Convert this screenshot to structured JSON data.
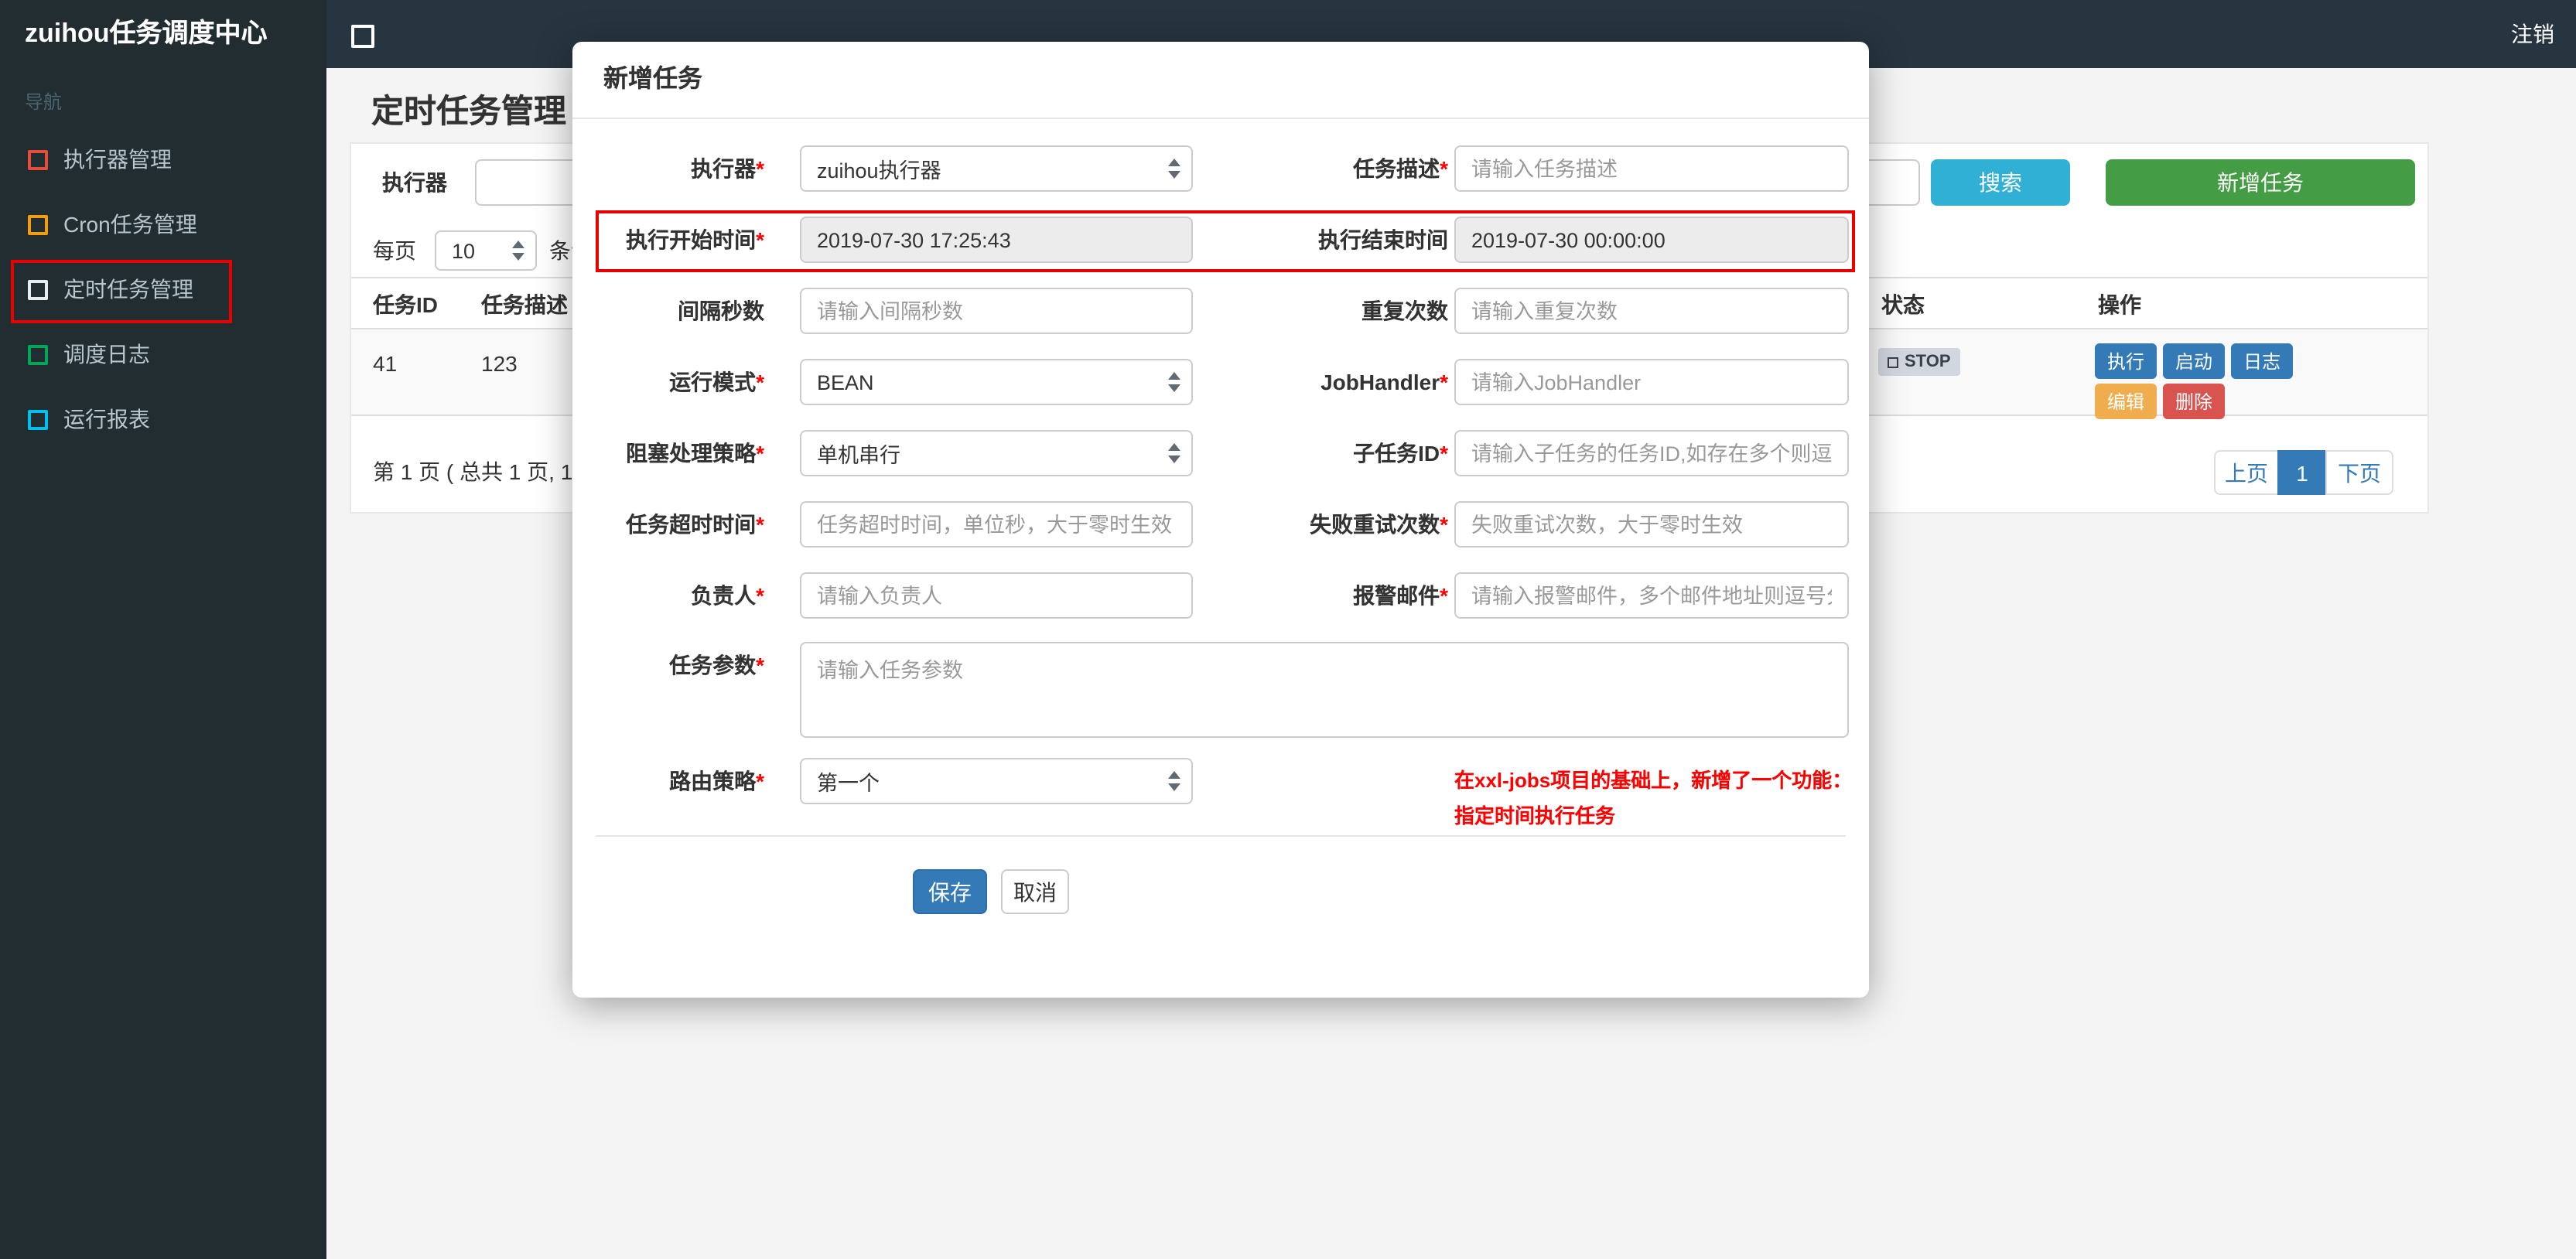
{
  "navbar": {
    "brand": "zuihou任务调度中心",
    "logout": "注销"
  },
  "sidebar": {
    "section_label": "导航",
    "items": [
      {
        "label": "执行器管理",
        "icon": "square-icon",
        "color": "#e74c3c"
      },
      {
        "label": "Cron任务管理",
        "icon": "square-icon",
        "color": "#f39c12"
      },
      {
        "label": "定时任务管理",
        "icon": "square-icon",
        "color": "#e8eef0",
        "highlighted": true
      },
      {
        "label": "调度日志",
        "icon": "square-icon",
        "color": "#00a65a"
      },
      {
        "label": "运行报表",
        "icon": "square-icon",
        "color": "#00c0ef"
      }
    ]
  },
  "page": {
    "title": "定时任务管理",
    "filter": {
      "executor_label": "执行器",
      "search_button": "搜索",
      "add_button": "新增任务"
    },
    "per_page": {
      "prefix": "每页",
      "value": "10",
      "suffix": "条记录"
    },
    "table": {
      "headers": {
        "job_id": "任务ID",
        "job_desc": "任务描述",
        "status": "状态",
        "actions": "操作"
      },
      "row": {
        "job_id": "41",
        "job_desc": "123",
        "status": "STOP",
        "actions": {
          "execute": "执行",
          "start": "启动",
          "log": "日志",
          "edit": "编辑",
          "delete": "删除"
        }
      }
    },
    "pagination": {
      "summary": "第 1 页 ( 总共 1 页, 1",
      "prev": "上页",
      "current": "1",
      "next": "下页"
    }
  },
  "modal": {
    "title": "新增任务",
    "fields": {
      "executor": {
        "label": "执行器",
        "star": "*",
        "value": "zuihou执行器"
      },
      "job_desc": {
        "label": "任务描述",
        "star": "*",
        "placeholder": "请输入任务描述"
      },
      "start_time": {
        "label": "执行开始时间",
        "star": "*",
        "value": "2019-07-30 17:25:43"
      },
      "end_time": {
        "label": "执行结束时间",
        "value": "2019-07-30 00:00:00"
      },
      "interval": {
        "label": "间隔秒数",
        "placeholder": "请输入间隔秒数"
      },
      "repeat_count": {
        "label": "重复次数",
        "placeholder": "请输入重复次数"
      },
      "run_mode": {
        "label": "运行模式",
        "star": "*",
        "value": "BEAN"
      },
      "job_handler": {
        "label": "JobHandler",
        "star": "*",
        "placeholder": "请输入JobHandler"
      },
      "block_strategy": {
        "label": "阻塞处理策略",
        "star": "*",
        "value": "单机串行"
      },
      "child_job_id": {
        "label": "子任务ID",
        "star": "*",
        "placeholder": "请输入子任务的任务ID,如存在多个则逗号分隔"
      },
      "timeout": {
        "label": "任务超时时间",
        "star": "*",
        "placeholder": "任务超时时间，单位秒，大于零时生效"
      },
      "fail_retry": {
        "label": "失败重试次数",
        "star": "*",
        "placeholder": "失败重试次数，大于零时生效"
      },
      "owner": {
        "label": "负责人",
        "star": "*",
        "placeholder": "请输入负责人"
      },
      "alarm_email": {
        "label": "报警邮件",
        "star": "*",
        "placeholder": "请输入报警邮件，多个邮件地址则逗号分隔"
      },
      "job_param": {
        "label": "任务参数",
        "star": "*",
        "placeholder": "请输入任务参数"
      },
      "route_strategy": {
        "label": "路由策略",
        "star": "*",
        "value": "第一个"
      }
    },
    "hint": {
      "line1": "在xxl-jobs项目的基础上，新增了一个功能：",
      "line2": "指定时间执行任务"
    },
    "save_button": "保存",
    "cancel_button": "取消"
  },
  "colors": {
    "search_button": "#31b0d5",
    "add_button": "#449d44",
    "primary_action": "#337ab7",
    "warning_action": "#f0ad4e",
    "danger_action": "#d9534f",
    "annotation_red": "#e60000",
    "hint_text": "#ff0000"
  }
}
